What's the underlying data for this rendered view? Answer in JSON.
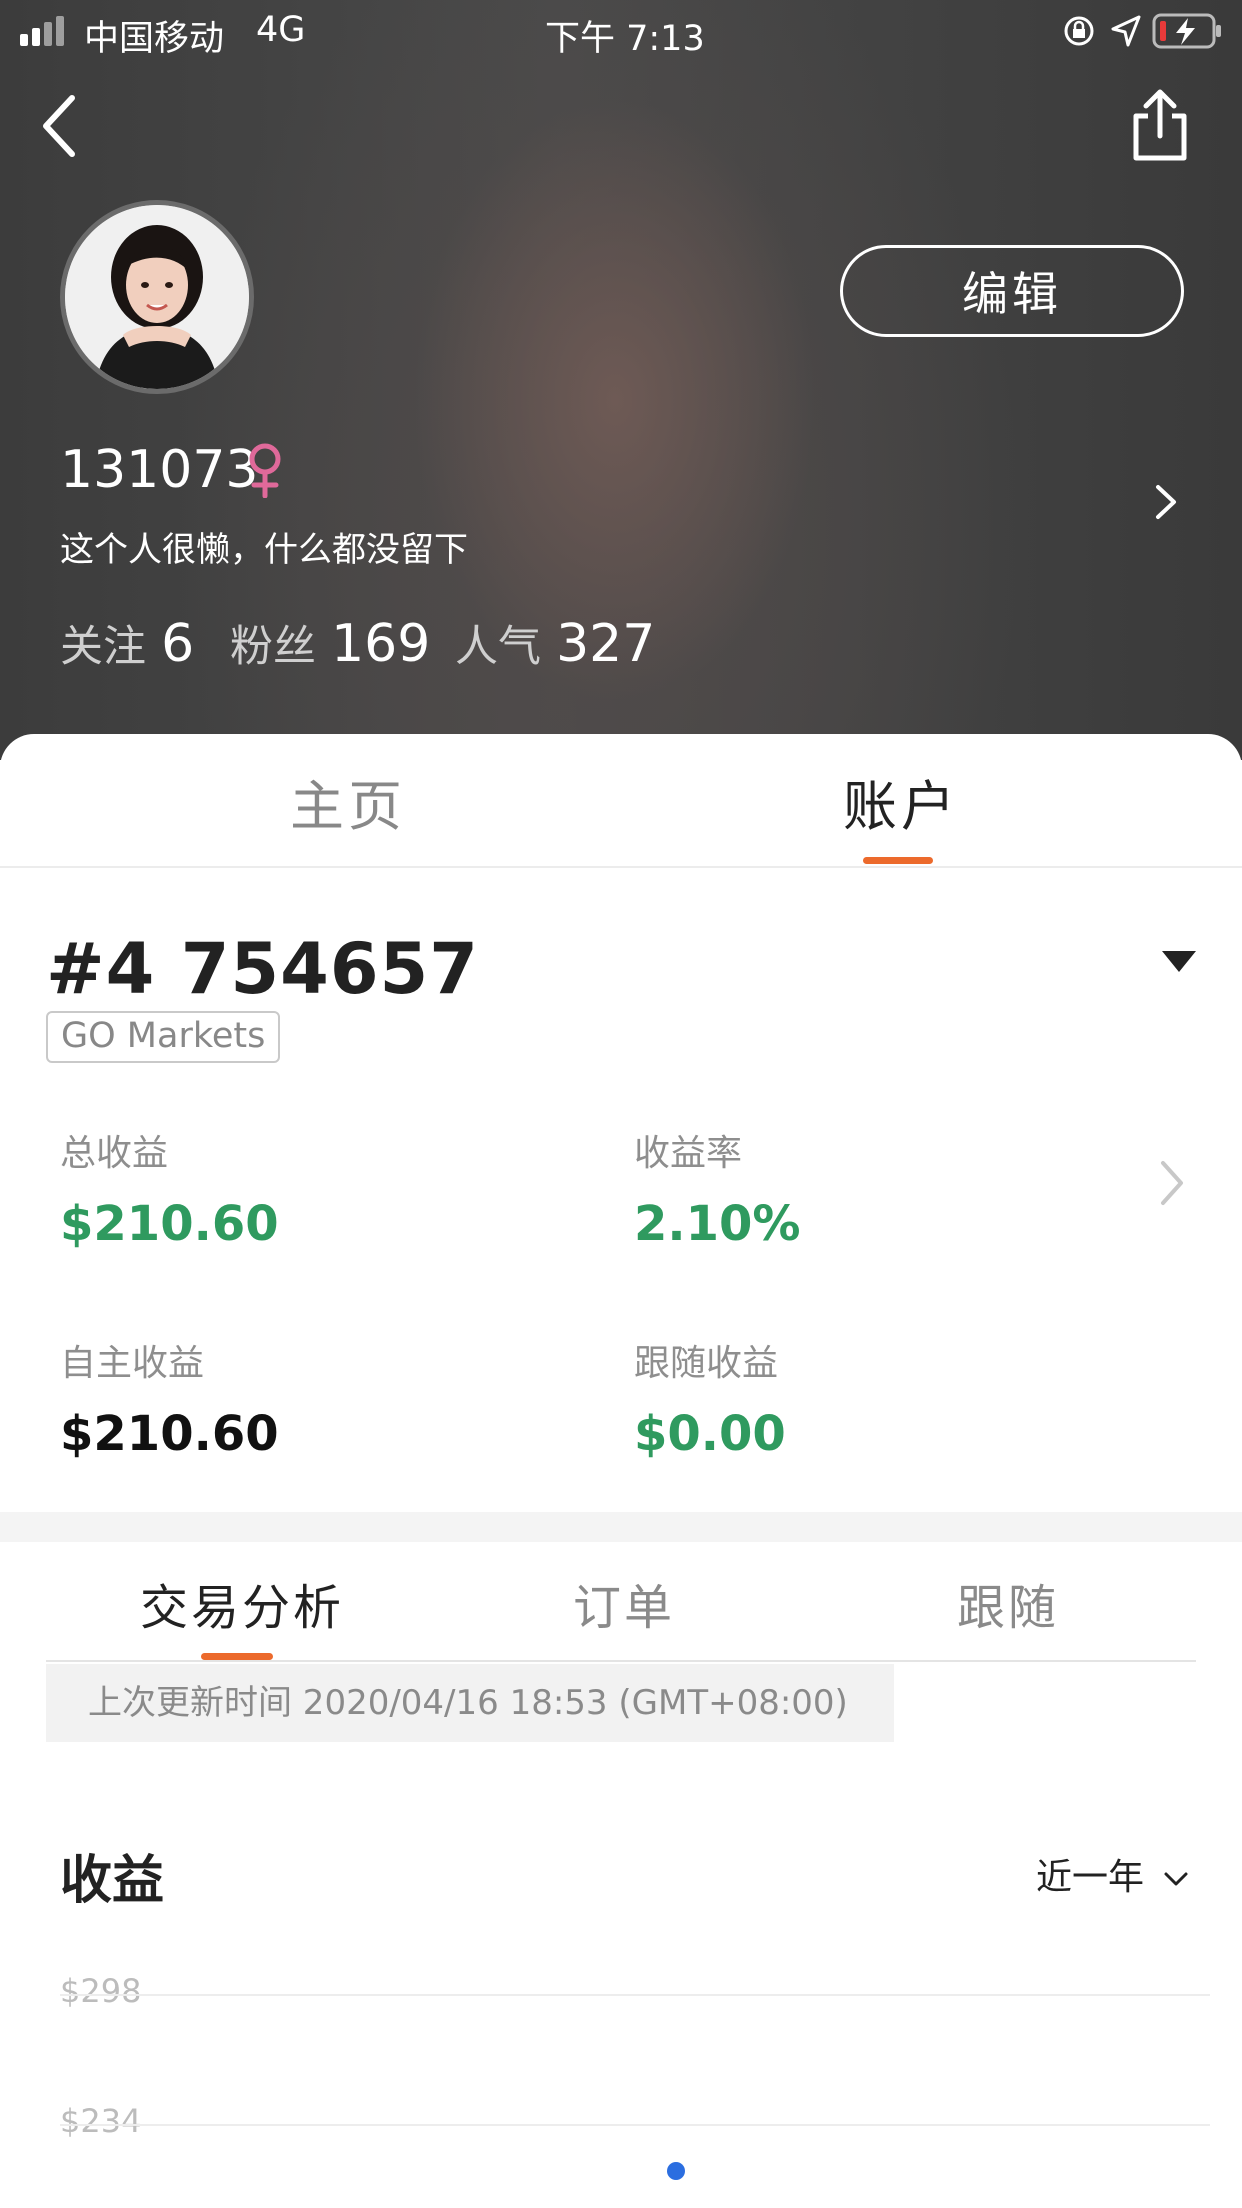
{
  "status_bar": {
    "carrier": "中国移动",
    "network": "4G",
    "time": "下午 7:13"
  },
  "profile": {
    "edit_label": "编辑",
    "username": "131073",
    "gender_symbol": "♀",
    "bio": "这个人很懒，什么都没留下",
    "stats": [
      {
        "label": "关注",
        "value": "6"
      },
      {
        "label": "粉丝",
        "value": "169"
      },
      {
        "label": "人气",
        "value": "327"
      }
    ]
  },
  "main_tabs": [
    {
      "label": "主页",
      "active": false
    },
    {
      "label": "账户",
      "active": true
    }
  ],
  "account": {
    "id": "#4 754657",
    "broker": "GO Markets",
    "metrics": [
      {
        "label": "总收益",
        "value": "$210.60",
        "color": "#2f9a5f"
      },
      {
        "label": "收益率",
        "value": "2.10%",
        "color": "#2f9a5f"
      },
      {
        "label": "自主收益",
        "value": "$210.60",
        "color": "#111111"
      },
      {
        "label": "跟随收益",
        "value": "$0.00",
        "color": "#2f9a5f"
      }
    ]
  },
  "sub_tabs": [
    {
      "label": "交易分析",
      "active": true
    },
    {
      "label": "订单",
      "active": false
    },
    {
      "label": "跟随",
      "active": false
    }
  ],
  "update_text": "上次更新时间 2020/04/16 18:53 (GMT+08:00)",
  "earnings": {
    "title": "收益",
    "range": "近一年",
    "y_ticks": [
      "$298",
      "$234"
    ]
  },
  "colors": {
    "accent": "#ec6a2c",
    "positive": "#2f9a5f",
    "gender": "#e0699a",
    "dot": "#2b6ee0"
  }
}
